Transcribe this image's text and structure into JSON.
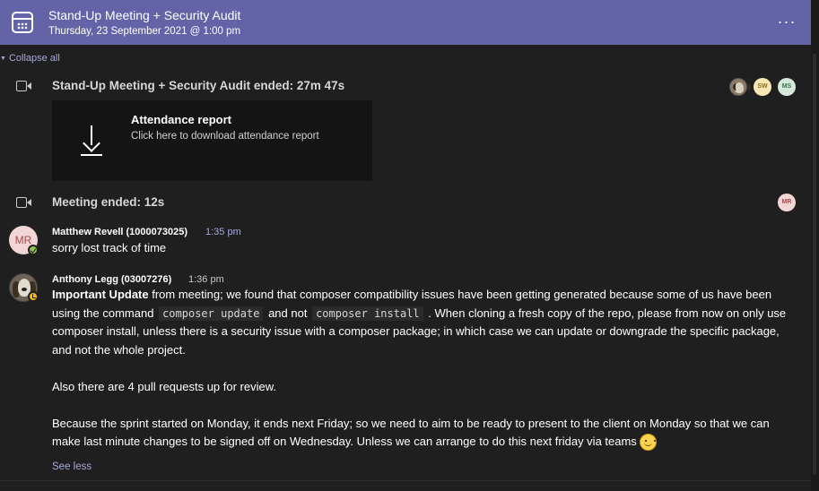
{
  "header": {
    "title": "Stand-Up Meeting + Security Audit",
    "subtitle": "Thursday, 23 September 2021 @ 1:00 pm",
    "more_label": "···",
    "icon": "calendar-icon",
    "color": "#6264a7"
  },
  "thread": {
    "collapse_label": "Collapse all",
    "see_less_label": "See less",
    "link_color": "#a6a7dc"
  },
  "events": [
    {
      "title": "Stand-Up Meeting + Security Audit ended: 27m 47s",
      "icon": "video-camera-icon",
      "participants": [
        {
          "initials": "",
          "type": "photo"
        },
        {
          "initials": "SW",
          "bg": "#f8e7b5",
          "fg": "#8a6d1b"
        },
        {
          "initials": "MS",
          "bg": "#d5e8dc",
          "fg": "#3c6e4c"
        }
      ]
    },
    {
      "title": "Meeting ended: 12s",
      "icon": "video-camera-icon",
      "participants": [
        {
          "initials": "MR",
          "bg": "#f2d5d5",
          "fg": "#a44a4a"
        }
      ]
    }
  ],
  "attendance": {
    "title": "Attendance report",
    "description": "Click here to download attendance report",
    "icon": "download-icon"
  },
  "messages": [
    {
      "author": "Matthew Revell (1000073025)",
      "time": "1:35 pm",
      "time_color": "#a6a7dc",
      "initials": "MR",
      "presence": "available",
      "text": "sorry lost track of time"
    },
    {
      "author": "Anthony Legg (03007276)",
      "time": "1:36 pm",
      "time_color": "#c8c8c8",
      "presence": "away",
      "p1_bold": "Important Update",
      "p1_a": " from meeting; we found that composer compatibility issues have been getting generated because some of us have been using the command ",
      "code1": "composer update",
      "p1_b": " and not ",
      "code2": "composer install",
      "p1_c": " . When cloning a fresh copy of the repo, please from now on only use composer install, unless there is a security issue with a composer package; in which case we can update or downgrade the specific package, and not the whole project.",
      "p2": "Also there are 4 pull requests up for review.",
      "p3": "Because the sprint started on Monday, it ends next Friday; so we need to aim to be ready to present to the client on Monday so that we can make last minute changes to be signed off on Wednesday. Unless we can arrange to do this next friday via teams",
      "emoji": "smiley-emoji"
    }
  ]
}
